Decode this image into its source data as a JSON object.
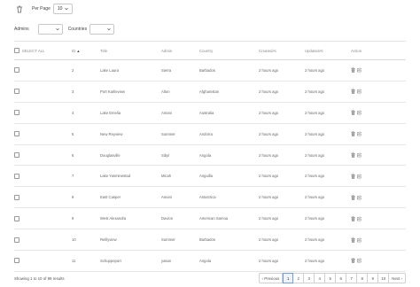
{
  "toolbar": {
    "per_page_label": "Per Page",
    "per_page_value": "10"
  },
  "filters": {
    "admins_label": "Admins",
    "countries_label": "Countries"
  },
  "table": {
    "headers": {
      "select_all": "SELECT ALL",
      "id": "ID",
      "sort_arrow": "▲",
      "title": "Title",
      "admin": "Admin",
      "country": "Country",
      "created": "CreatedAt",
      "updated": "UpdatedAt",
      "action": "Action"
    },
    "rows": [
      {
        "id": "2",
        "title": "Lake Laura",
        "admin": "Sierra",
        "country": "Barbados",
        "created": "2 hours ago",
        "updated": "2 hours ago"
      },
      {
        "id": "3",
        "title": "Port Karlieview",
        "admin": "Alton",
        "country": "Afghanistan",
        "created": "2 hours ago",
        "updated": "2 hours ago"
      },
      {
        "id": "4",
        "title": "Lake Emelia",
        "admin": "Amani",
        "country": "Australia",
        "created": "2 hours ago",
        "updated": "2 hours ago"
      },
      {
        "id": "5",
        "title": "New Reyview",
        "admin": "Summer",
        "country": "Andorra",
        "created": "2 hours ago",
        "updated": "2 hours ago"
      },
      {
        "id": "6",
        "title": "Douglasville",
        "admin": "Sibyl",
        "country": "Angola",
        "created": "2 hours ago",
        "updated": "2 hours ago"
      },
      {
        "id": "7",
        "title": "Lake Yasminestad",
        "admin": "Micah",
        "country": "Anguilla",
        "created": "2 hours ago",
        "updated": "2 hours ago"
      },
      {
        "id": "8",
        "title": "East Casper",
        "admin": "Amani",
        "country": "Antarctica",
        "created": "2 hours ago",
        "updated": "2 hours ago"
      },
      {
        "id": "9",
        "title": "West Alexandra",
        "admin": "Davion",
        "country": "American Samoa",
        "created": "2 hours ago",
        "updated": "2 hours ago"
      },
      {
        "id": "10",
        "title": "Reillyview",
        "admin": "Summer",
        "country": "Barbados",
        "created": "2 hours ago",
        "updated": "2 hours ago"
      },
      {
        "id": "11",
        "title": "Schuppeport",
        "admin": "yasan",
        "country": "Angola",
        "created": "2 hours ago",
        "updated": "2 hours ago"
      }
    ]
  },
  "footer": {
    "results_text": "Showing 1 to 10 of 99 results",
    "prev": "‹ Previous",
    "next": "Next ›",
    "pages": [
      "1",
      "2",
      "3",
      "4",
      "5",
      "6",
      "7",
      "8",
      "9",
      "10"
    ],
    "active_page": "1"
  },
  "colors": {
    "active_page_border": "#7a9ccf",
    "row_border": "#e6e6e6"
  },
  "icons": {
    "bulk": "trash-icon",
    "row_delete": "trash-icon",
    "row_edit": "edit-icon",
    "select": "chevron-down-icon"
  }
}
